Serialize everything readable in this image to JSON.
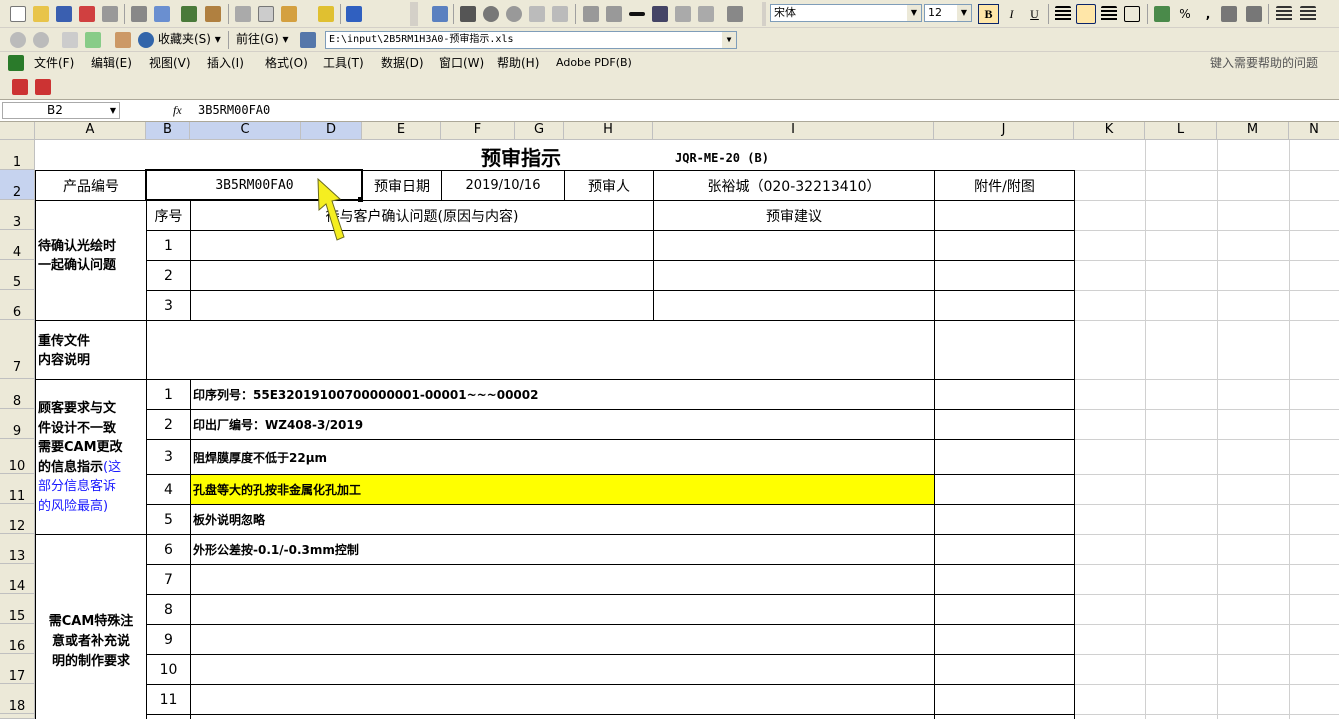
{
  "toolbar": {
    "font_name": "宋体",
    "font_size": "12",
    "bold_label": "B",
    "italic_label": "I",
    "underline_label": "U",
    "percent_label": "%",
    "comma_label": ","
  },
  "nav_bar": {
    "favorites_label": "收藏夹(S)",
    "goto_label": "前往(G)",
    "path": "E:\\input\\2B5RM1H3A0-预审指示.xls"
  },
  "menu": {
    "items": [
      "文件(F)",
      "编辑(E)",
      "视图(V)",
      "插入(I)",
      "格式(O)",
      "工具(T)",
      "数据(D)",
      "窗口(W)",
      "帮助(H)",
      "Adobe PDF(B)"
    ],
    "help_prompt": "键入需要帮助的问题"
  },
  "formula_bar": {
    "name_box": "B2",
    "fx": "fx",
    "content": "3B5RM00FA0"
  },
  "grid": {
    "columns": [
      "A",
      "B",
      "C",
      "D",
      "E",
      "F",
      "G",
      "H",
      "I",
      "J",
      "K",
      "L",
      "M",
      "N"
    ],
    "rows": [
      "1",
      "2",
      "3",
      "4",
      "5",
      "6",
      "7",
      "8",
      "9",
      "10",
      "11",
      "12",
      "13",
      "14",
      "15",
      "16",
      "17",
      "18"
    ]
  },
  "sheet": {
    "title": "预审指示",
    "doc_code": "JQR-ME-20 (B)",
    "product_no_label": "产品编号",
    "product_no": "3B5RM00FA0",
    "review_date_label": "预审日期",
    "review_date": "2019/10/16",
    "reviewer_label": "预审人",
    "reviewer": "张裕城（020-32213410）",
    "attachment_label": "附件/附图",
    "section1_line1": "待确认光绘时",
    "section1_line2": "一起确认问题",
    "seq_label": "序号",
    "question_header": "待与客户确认问题(原因与内容)",
    "suggestion_header": "预审建议",
    "section1_rows": [
      "1",
      "2",
      "3"
    ],
    "section2_line1": "重传文件",
    "section2_line2": "内容说明",
    "section3_lines": [
      "顾客要求与文",
      "件设计不一致",
      "需要CAM更改",
      "的信息指示"
    ],
    "section3_note_a": "(这",
    "section3_note_lines": [
      "部分信息客诉",
      "的风险最高)"
    ],
    "section3_rows": [
      {
        "seq": "1",
        "text": "印序列号：55E32019100700000001-00001~~~00002"
      },
      {
        "seq": "2",
        "text": "印出厂编号：WZ408-3/2019"
      },
      {
        "seq": "3",
        "text": "阻焊膜厚度不低于22μm"
      },
      {
        "seq": "4",
        "text": "孔盘等大的孔按非金属化孔加工"
      },
      {
        "seq": "5",
        "text": "板外说明忽略"
      }
    ],
    "section4_lines": [
      "需CAM特殊注",
      "意或者补充说",
      "明的制作要求"
    ],
    "section4_rows": [
      {
        "seq": "6",
        "text": "外形公差按-0.1/-0.3mm控制"
      },
      {
        "seq": "7",
        "text": ""
      },
      {
        "seq": "8",
        "text": ""
      },
      {
        "seq": "9",
        "text": ""
      },
      {
        "seq": "10",
        "text": ""
      },
      {
        "seq": "11",
        "text": ""
      }
    ]
  },
  "colors": {
    "highlight": "#ffff00",
    "note_text": "#1a1aff",
    "header_bg": "#ece9d8",
    "selected_header": "#c6d3ef"
  }
}
